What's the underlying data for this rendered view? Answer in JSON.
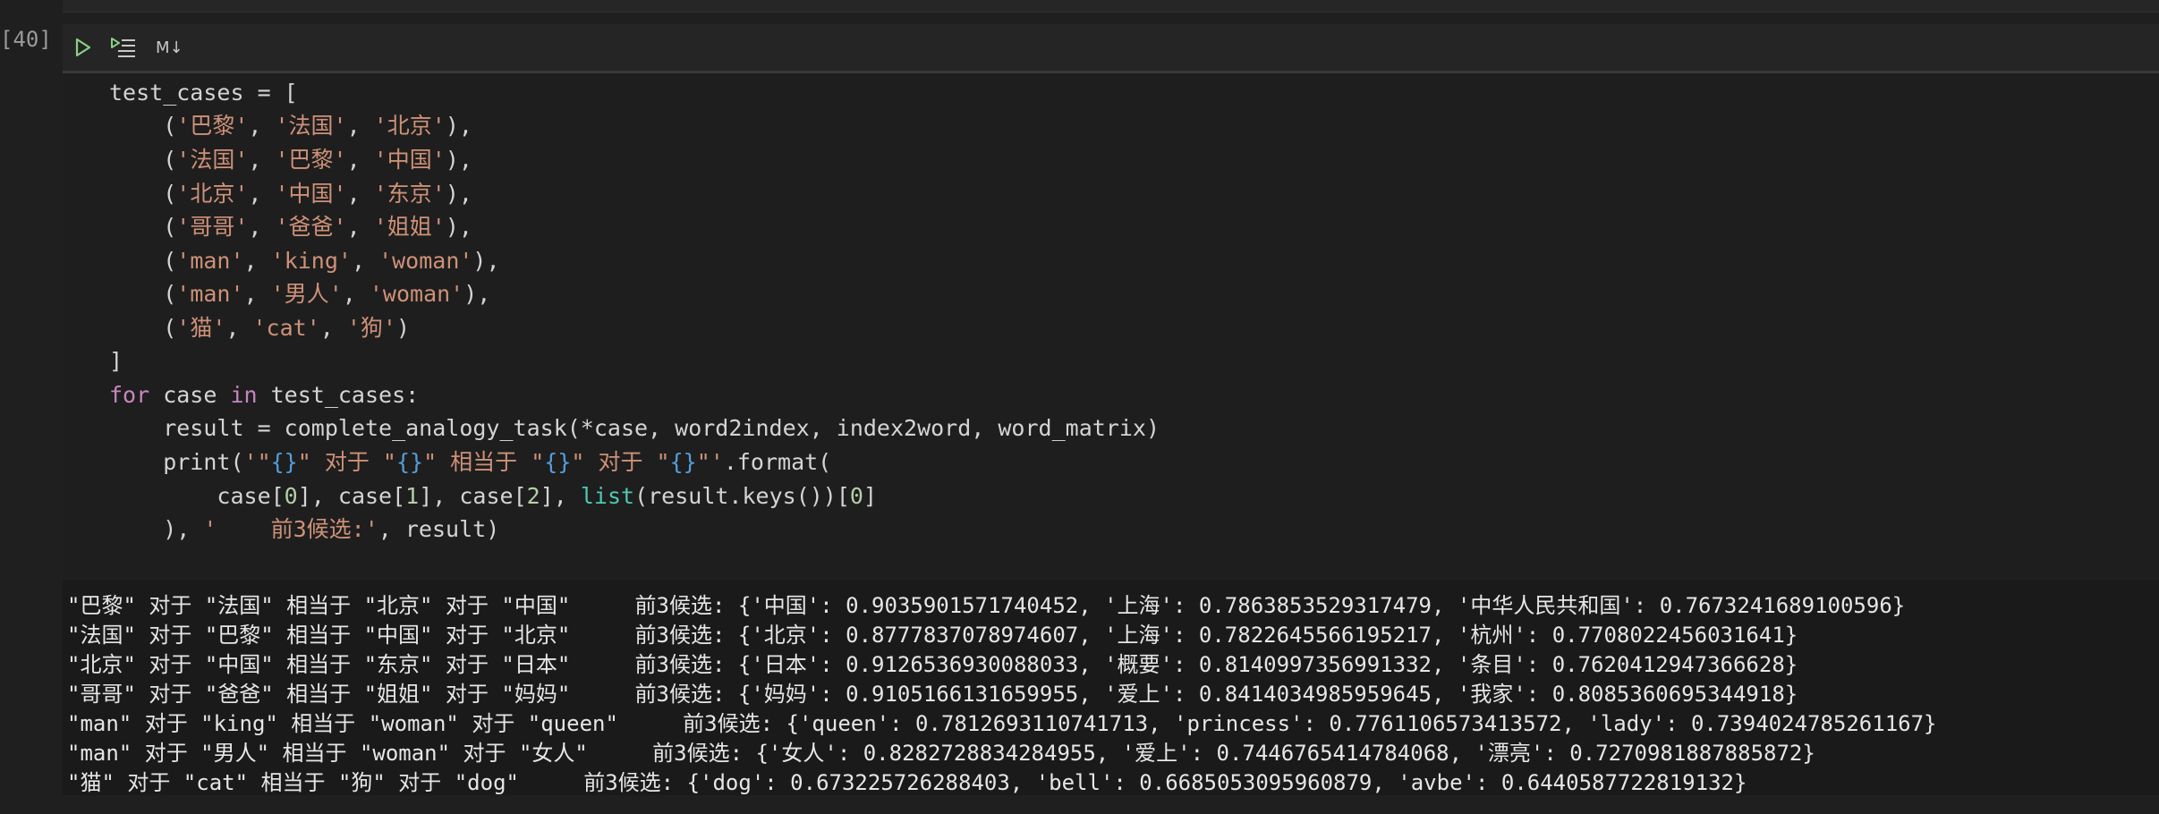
{
  "execution_count": "[40]",
  "toolbar": {
    "run_icon": "play-icon",
    "run_all_icon": "run-below-icon",
    "markdown_label": "M↓"
  },
  "code": {
    "l1": "test_cases = [",
    "l2_a": "    (",
    "l2_s1": "'巴黎'",
    "l2_s2": "'法国'",
    "l2_s3": "'北京'",
    "l3_s1": "'法国'",
    "l3_s2": "'巴黎'",
    "l3_s3": "'中国'",
    "l4_s1": "'北京'",
    "l4_s2": "'中国'",
    "l4_s3": "'东京'",
    "l5_s1": "'哥哥'",
    "l5_s2": "'爸爸'",
    "l5_s3": "'姐姐'",
    "l6_s1": "'man'",
    "l6_s2": "'king'",
    "l6_s3": "'woman'",
    "l7_s1": "'man'",
    "l7_s2": "'男人'",
    "l7_s3": "'woman'",
    "l8_s1": "'猫'",
    "l8_s2": "'cat'",
    "l8_s3": "'狗'",
    "l9": "]",
    "l10_kw1": "for",
    "l10_mid": " case ",
    "l10_kw2": "in",
    "l10_rest": " test_cases:",
    "l11": "    result = complete_analogy_task(*case, word2index, index2word, word_matrix)",
    "l12_a": "    print(",
    "l12_q1": "'\"",
    "l12_b1": "{}",
    "l12_q2": "\" 对于 \"",
    "l12_b2": "{}",
    "l12_q3": "\" 相当于 \"",
    "l12_b3": "{}",
    "l12_q4": "\" 对于 \"",
    "l12_b4": "{}",
    "l12_q5": "\"'",
    "l12_c": ".format(",
    "l13_a": "        case[",
    "l13_n0": "0",
    "l13_b": "], case[",
    "l13_n1": "1",
    "l13_c": "], case[",
    "l13_n2": "2",
    "l13_d": "], ",
    "l13_fn": "list",
    "l13_e": "(result.keys())[",
    "l13_n3": "0",
    "l13_f": "]",
    "l14_a": "    ), ",
    "l14_s": "'    前3候选:'",
    "l14_b": ", result)"
  },
  "output": [
    "\"巴黎\" 对于 \"法国\" 相当于 \"北京\" 对于 \"中国\"     前3候选: {'中国': 0.9035901571740452, '上海': 0.7863853529317479, '中华人民共和国': 0.7673241689100596}",
    "\"法国\" 对于 \"巴黎\" 相当于 \"中国\" 对于 \"北京\"     前3候选: {'北京': 0.8777837078974607, '上海': 0.7822645566195217, '杭州': 0.7708022456031641}",
    "\"北京\" 对于 \"中国\" 相当于 \"东京\" 对于 \"日本\"     前3候选: {'日本': 0.9126536930088033, '概要': 0.8140997356991332, '条目': 0.7620412947366628}",
    "\"哥哥\" 对于 \"爸爸\" 相当于 \"姐姐\" 对于 \"妈妈\"     前3候选: {'妈妈': 0.9105166131659955, '爱上': 0.8414034985959645, '我家': 0.8085360695344918}",
    "\"man\" 对于 \"king\" 相当于 \"woman\" 对于 \"queen\"     前3候选: {'queen': 0.7812693110741713, 'princess': 0.7761106573413572, 'lady': 0.7394024785261167}",
    "\"man\" 对于 \"男人\" 相当于 \"woman\" 对于 \"女人\"     前3候选: {'女人': 0.8282728834284955, '爱上': 0.7446765414784068, '漂亮': 0.7270981887885872}",
    "\"猫\" 对于 \"cat\" 相当于 \"狗\" 对于 \"dog\"     前3候选: {'dog': 0.673225726288403, 'bell': 0.6685053095960879, 'avbe': 0.6440587722819132}"
  ]
}
